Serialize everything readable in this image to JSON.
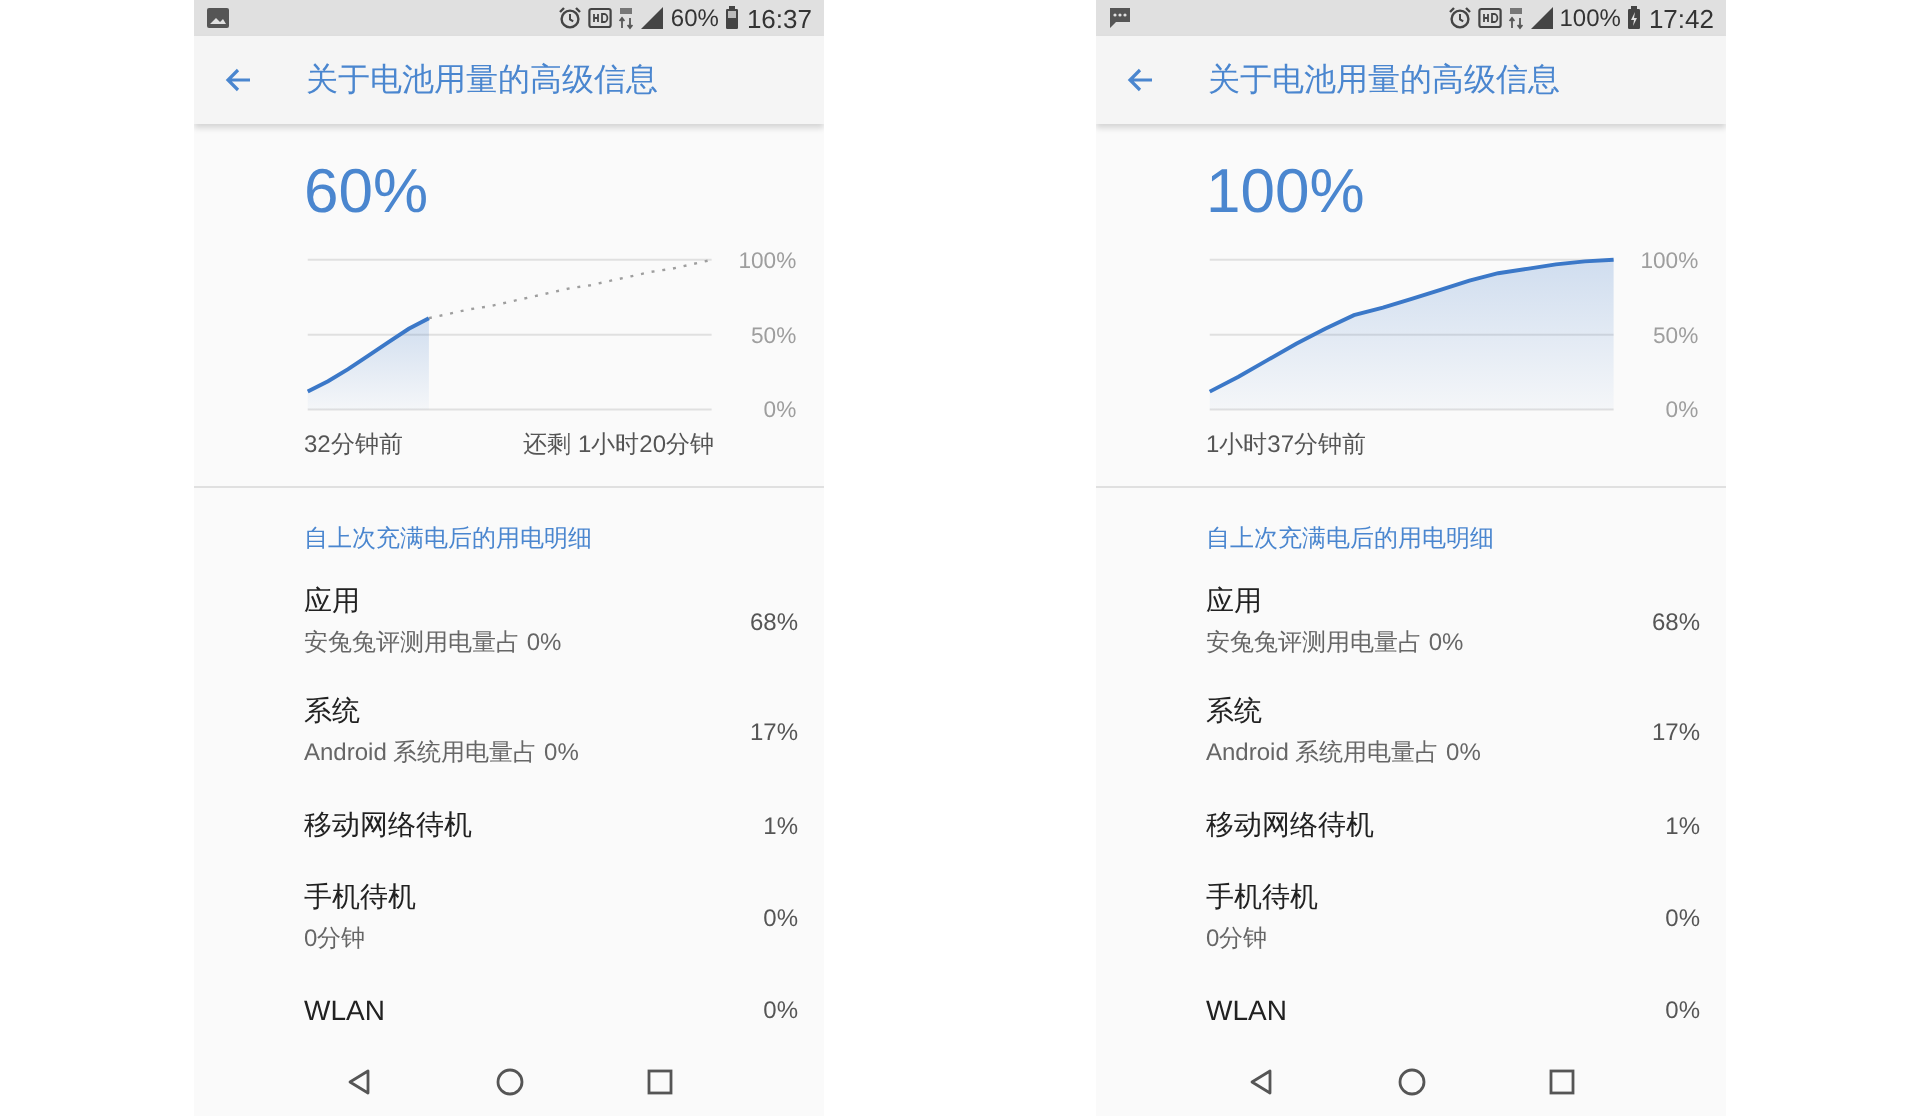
{
  "screens": [
    {
      "status_bar": {
        "notification_icons": [
          {
            "kind": "image"
          }
        ],
        "battery_text": "60%",
        "time": "16:37",
        "charging": false
      },
      "title": "关于电池用量的高级信息",
      "level_text": "60%",
      "chart_data": {
        "type": "area",
        "ylim": [
          0,
          100
        ],
        "yticks": [
          {
            "value": 100,
            "label": "100%"
          },
          {
            "value": 50,
            "label": "50%"
          },
          {
            "value": 0,
            "label": "0%"
          }
        ],
        "series": [
          {
            "color": "#3b78c8",
            "values": [
              12,
              19,
              27,
              36,
              45,
              54,
              61,
              null,
              null,
              null,
              null,
              null,
              null,
              null,
              null,
              null,
              null,
              null,
              null,
              null,
              null
            ]
          },
          {
            "type": "line",
            "color": "#9e9e9e",
            "line_style": "dashed",
            "values": [
              null,
              null,
              null,
              null,
              null,
              null,
              61,
              64,
              67,
              69,
              72,
              75,
              78,
              81,
              83,
              86,
              89,
              92,
              94,
              97,
              100
            ]
          }
        ]
      },
      "time_labels": [
        "32分钟前",
        "还剩 1小时20分钟"
      ],
      "section_title": "自上次充满电后的用电明细",
      "items": [
        {
          "title": "应用",
          "subtitle": "安兔兔评测用电量占 0%",
          "percent": "68%"
        },
        {
          "title": "系统",
          "subtitle": "Android 系统用电量占 0%",
          "percent": "17%"
        },
        {
          "title": "移动网络待机",
          "percent": "1%"
        },
        {
          "title": "手机待机",
          "subtitle": "0分钟",
          "percent": "0%"
        },
        {
          "title": "WLAN",
          "percent": "0%"
        }
      ]
    },
    {
      "status_bar": {
        "notification_icons": [
          {
            "kind": "message"
          }
        ],
        "battery_text": "100%",
        "time": "17:42",
        "charging": true
      },
      "title": "关于电池用量的高级信息",
      "level_text": "100%",
      "chart_data": {
        "type": "area",
        "ylim": [
          0,
          100
        ],
        "yticks": [
          {
            "value": 100,
            "label": "100%"
          },
          {
            "value": 50,
            "label": "50%"
          },
          {
            "value": 0,
            "label": "0%"
          }
        ],
        "series": [
          {
            "color": "#3b78c8",
            "values": [
              12,
              22,
              33,
              44,
              54,
              63,
              68,
              74,
              80,
              86,
              91,
              94,
              97,
              99,
              100
            ]
          }
        ]
      },
      "time_labels": [
        "1小时37分钟前"
      ],
      "section_title": "自上次充满电后的用电明细",
      "items": [
        {
          "title": "应用",
          "subtitle": "安兔兔评测用电量占 0%",
          "percent": "68%"
        },
        {
          "title": "系统",
          "subtitle": "Android 系统用电量占 0%",
          "percent": "17%"
        },
        {
          "title": "移动网络待机",
          "percent": "1%"
        },
        {
          "title": "手机待机",
          "subtitle": "0分钟",
          "percent": "0%"
        },
        {
          "title": "WLAN",
          "percent": "0%"
        }
      ]
    }
  ]
}
